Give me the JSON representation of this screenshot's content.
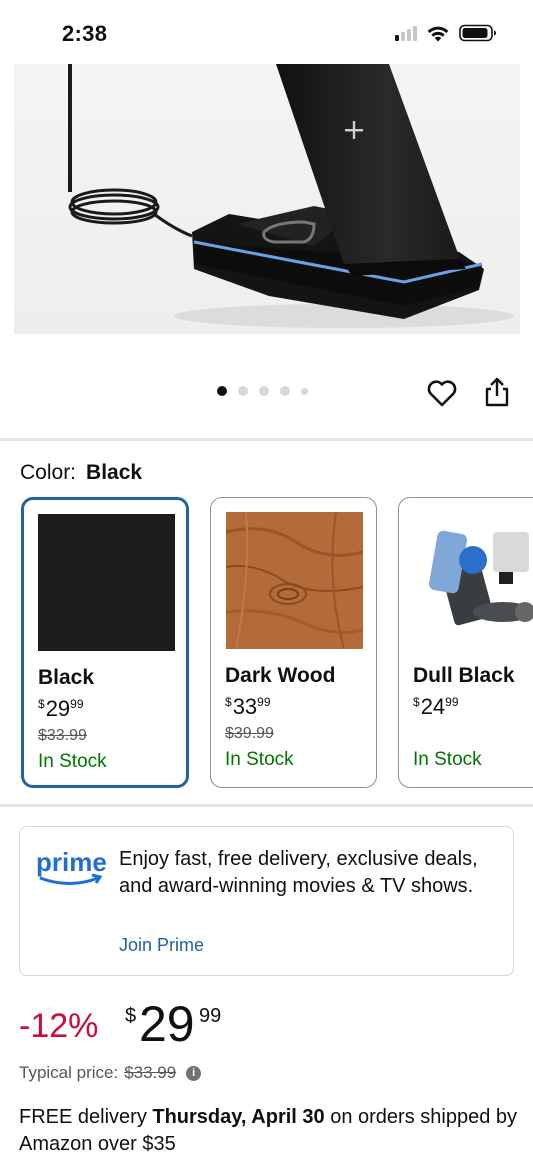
{
  "status_bar": {
    "time": "2:38",
    "icons": [
      "cellular-signal-icon",
      "wifi-icon",
      "battery-icon"
    ]
  },
  "carousel": {
    "dot_count": 5,
    "active_index": 0
  },
  "actions": {
    "wishlist_icon": "heart-outline-icon",
    "share_icon": "share-icon"
  },
  "color": {
    "label": "Color:",
    "selected": "Black",
    "options": [
      {
        "name": "Black",
        "price_currency": "$",
        "price_whole": "29",
        "price_fraction": "99",
        "list_price": "$33.99",
        "stock": "In Stock",
        "swatch": "#1b1c1b"
      },
      {
        "name": "Dark Wood",
        "price_currency": "$",
        "price_whole": "33",
        "price_fraction": "99",
        "list_price": "$39.99",
        "stock": "In Stock",
        "swatch": "#b26a37"
      },
      {
        "name": "Dull Black",
        "price_currency": "$",
        "price_whole": "24",
        "price_fraction": "99",
        "list_price": "",
        "stock": "In Stock",
        "swatch": "#3a3d40"
      }
    ]
  },
  "prime": {
    "logo_text": "prime",
    "message": "Enjoy fast, free delivery, exclusive deals, and award-winning movies & TV shows.",
    "link": "Join Prime"
  },
  "price": {
    "discount": "-12%",
    "currency": "$",
    "whole": "29",
    "fraction": "99",
    "typical_label": "Typical price:",
    "typical_value": "$33.99",
    "info_icon": "info-icon"
  },
  "delivery": {
    "prefix": "FREE delivery",
    "date": "Thursday, April 30",
    "suffix": "on orders shipped by Amazon over $35"
  },
  "colors": {
    "link": "#2162a1",
    "selected_border": "#2162a1",
    "in_stock": "#007600",
    "discount": "#cc0c39"
  }
}
